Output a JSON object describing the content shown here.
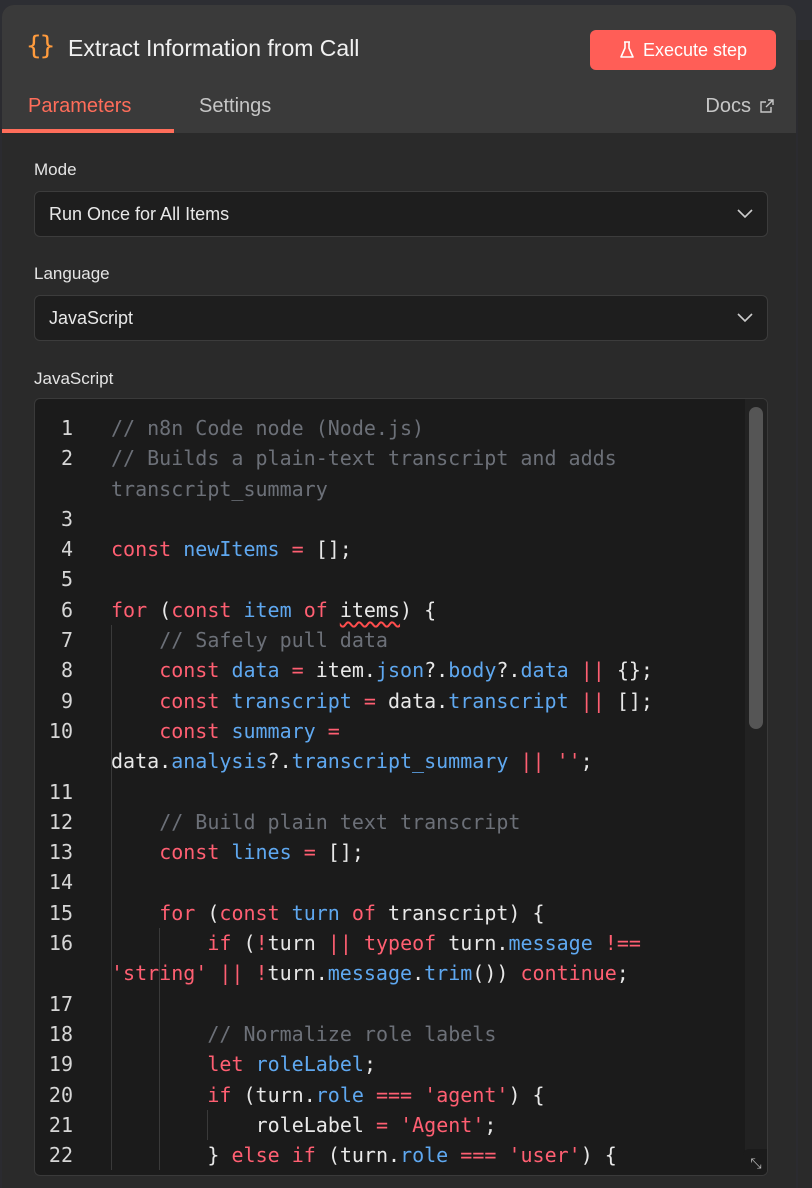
{
  "node": {
    "icon": "code-braces-icon",
    "icon_text": "{}",
    "title": "Extract Information from Call",
    "execute_label": "Execute step"
  },
  "tabs": [
    {
      "label": "Parameters",
      "active": true
    },
    {
      "label": "Settings",
      "active": false
    }
  ],
  "docs_label": "Docs",
  "mode": {
    "label": "Mode",
    "value": "Run Once for All Items"
  },
  "language": {
    "label": "Language",
    "value": "JavaScript"
  },
  "code_label": "JavaScript",
  "colors": {
    "accent": "#ff6d5a",
    "button": "#ff5e57",
    "keyword": "#ff5f72",
    "identifier": "#5fa8f0",
    "comment": "#6c7078"
  },
  "code_rows": [
    {
      "n": "1",
      "i": 0,
      "t": [
        [
          "c",
          "// n8n Code node (Node.js)"
        ]
      ]
    },
    {
      "n": "2",
      "i": 0,
      "t": [
        [
          "c",
          "// Builds a plain-text transcript and adds"
        ]
      ]
    },
    {
      "n": "",
      "i": 0,
      "t": [
        [
          "c",
          "transcript_summary"
        ]
      ]
    },
    {
      "n": "3",
      "i": 0,
      "t": []
    },
    {
      "n": "4",
      "i": 0,
      "t": [
        [
          "k",
          "const "
        ],
        [
          "v",
          "newItems"
        ],
        [
          "k",
          " = "
        ],
        [
          "p",
          "[];"
        ]
      ]
    },
    {
      "n": "5",
      "i": 0,
      "t": []
    },
    {
      "n": "6",
      "i": 0,
      "t": [
        [
          "k",
          "for "
        ],
        [
          "p",
          "("
        ],
        [
          "k",
          "const "
        ],
        [
          "v",
          "item "
        ],
        [
          "k",
          "of "
        ],
        [
          "q",
          "items"
        ],
        [
          "p",
          ") {"
        ]
      ]
    },
    {
      "n": "7",
      "i": 1,
      "t": [
        [
          "c",
          "// Safely pull data"
        ]
      ]
    },
    {
      "n": "8",
      "i": 1,
      "t": [
        [
          "k",
          "const "
        ],
        [
          "v",
          "data"
        ],
        [
          "k",
          " = "
        ],
        [
          "p",
          "item."
        ],
        [
          "v",
          "json"
        ],
        [
          "p",
          "?."
        ],
        [
          "v",
          "body"
        ],
        [
          "p",
          "?."
        ],
        [
          "v",
          "data"
        ],
        [
          "k",
          " || "
        ],
        [
          "p",
          "{};"
        ]
      ]
    },
    {
      "n": "9",
      "i": 1,
      "t": [
        [
          "k",
          "const "
        ],
        [
          "v",
          "transcript"
        ],
        [
          "k",
          " = "
        ],
        [
          "p",
          "data."
        ],
        [
          "v",
          "transcript"
        ],
        [
          "k",
          " || "
        ],
        [
          "p",
          "[];"
        ]
      ]
    },
    {
      "n": "10",
      "i": 1,
      "t": [
        [
          "k",
          "const "
        ],
        [
          "v",
          "summary"
        ],
        [
          "k",
          " ="
        ]
      ]
    },
    {
      "n": "",
      "i": 0,
      "g": 1,
      "t": [
        [
          "p",
          "data."
        ],
        [
          "v",
          "analysis"
        ],
        [
          "p",
          "?."
        ],
        [
          "v",
          "transcript_summary"
        ],
        [
          "k",
          " || "
        ],
        [
          "s",
          "''"
        ],
        [
          "p",
          ";"
        ]
      ]
    },
    {
      "n": "11",
      "i": 1,
      "t": []
    },
    {
      "n": "12",
      "i": 1,
      "t": [
        [
          "c",
          "// Build plain text transcript"
        ]
      ]
    },
    {
      "n": "13",
      "i": 1,
      "t": [
        [
          "k",
          "const "
        ],
        [
          "v",
          "lines"
        ],
        [
          "k",
          " = "
        ],
        [
          "p",
          "[];"
        ]
      ]
    },
    {
      "n": "14",
      "i": 1,
      "t": []
    },
    {
      "n": "15",
      "i": 1,
      "t": [
        [
          "k",
          "for "
        ],
        [
          "p",
          "("
        ],
        [
          "k",
          "const "
        ],
        [
          "v",
          "turn "
        ],
        [
          "k",
          "of "
        ],
        [
          "p",
          "transcript) {"
        ]
      ]
    },
    {
      "n": "16",
      "i": 2,
      "t": [
        [
          "k",
          "if "
        ],
        [
          "p",
          "("
        ],
        [
          "k",
          "!"
        ],
        [
          "p",
          "turn"
        ],
        [
          "k",
          " || typeof "
        ],
        [
          "p",
          "turn."
        ],
        [
          "v",
          "message"
        ],
        [
          "k",
          " !=="
        ]
      ]
    },
    {
      "n": "",
      "i": 0,
      "g": 2,
      "t": [
        [
          "s",
          "'string'"
        ],
        [
          "k",
          " || !"
        ],
        [
          "p",
          "turn."
        ],
        [
          "v",
          "message"
        ],
        [
          "p",
          "."
        ],
        [
          "v",
          "trim"
        ],
        [
          "p",
          "()) "
        ],
        [
          "k",
          "continue"
        ],
        [
          "p",
          ";"
        ]
      ]
    },
    {
      "n": "17",
      "i": 2,
      "t": []
    },
    {
      "n": "18",
      "i": 2,
      "t": [
        [
          "c",
          "// Normalize role labels"
        ]
      ]
    },
    {
      "n": "19",
      "i": 2,
      "t": [
        [
          "k",
          "let "
        ],
        [
          "v",
          "roleLabel"
        ],
        [
          "p",
          ";"
        ]
      ]
    },
    {
      "n": "20",
      "i": 2,
      "t": [
        [
          "k",
          "if "
        ],
        [
          "p",
          "(turn."
        ],
        [
          "v",
          "role"
        ],
        [
          "k",
          " === "
        ],
        [
          "s",
          "'agent'"
        ],
        [
          "p",
          ") {"
        ]
      ]
    },
    {
      "n": "21",
      "i": 3,
      "t": [
        [
          "p",
          "roleLabel"
        ],
        [
          "k",
          " = "
        ],
        [
          "s",
          "'Agent'"
        ],
        [
          "p",
          ";"
        ]
      ]
    },
    {
      "n": "22",
      "i": 2,
      "t": [
        [
          "p",
          "} "
        ],
        [
          "k",
          "else if "
        ],
        [
          "p",
          "(turn."
        ],
        [
          "v",
          "role"
        ],
        [
          "k",
          " === "
        ],
        [
          "s",
          "'user'"
        ],
        [
          "p",
          ") {"
        ]
      ]
    }
  ]
}
